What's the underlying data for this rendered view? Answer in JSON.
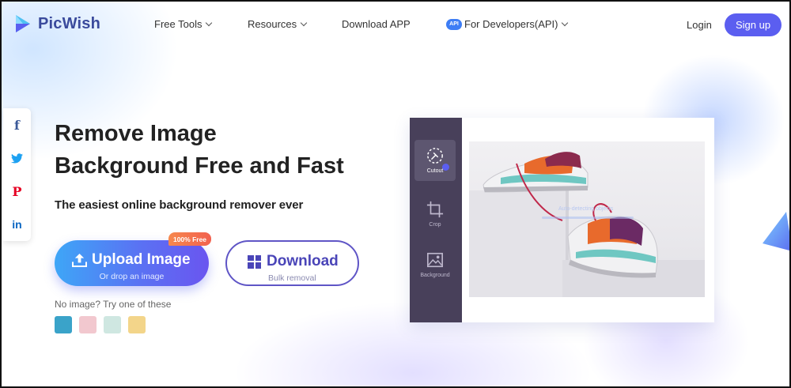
{
  "brand": {
    "name": "PicWish",
    "accent": "#5b5ef0",
    "logo_icon": "picwish-logo-icon"
  },
  "nav": {
    "free_tools": "Free Tools",
    "resources": "Resources",
    "download_app": "Download APP",
    "api_badge": "API",
    "developers": "For Developers(API)",
    "login": "Login",
    "signup": "Sign up"
  },
  "social": {
    "items": [
      "f",
      "twitter-icon",
      "P",
      "in"
    ]
  },
  "hero": {
    "title_line1": "Remove Image",
    "title_line2": "Background Free and Fast",
    "subtitle": "The easiest online background remover ever"
  },
  "upload": {
    "label": "Upload Image",
    "sub": "Or drop an image",
    "badge": "100% Free"
  },
  "download": {
    "label": "Download",
    "sub": "Bulk removal"
  },
  "samples": {
    "prompt": "No image? Try one of these",
    "colors": [
      "#3aa3c9",
      "#f2c8cf",
      "#cfe7e1",
      "#f3d58a"
    ]
  },
  "demo": {
    "tools": [
      {
        "label": "Cutout",
        "icon": "cutout-icon",
        "active": true
      },
      {
        "label": "Crop",
        "icon": "crop-icon",
        "active": false
      },
      {
        "label": "Background",
        "icon": "image-icon",
        "active": false
      }
    ],
    "scan_label": "Auto-detecting objects"
  }
}
